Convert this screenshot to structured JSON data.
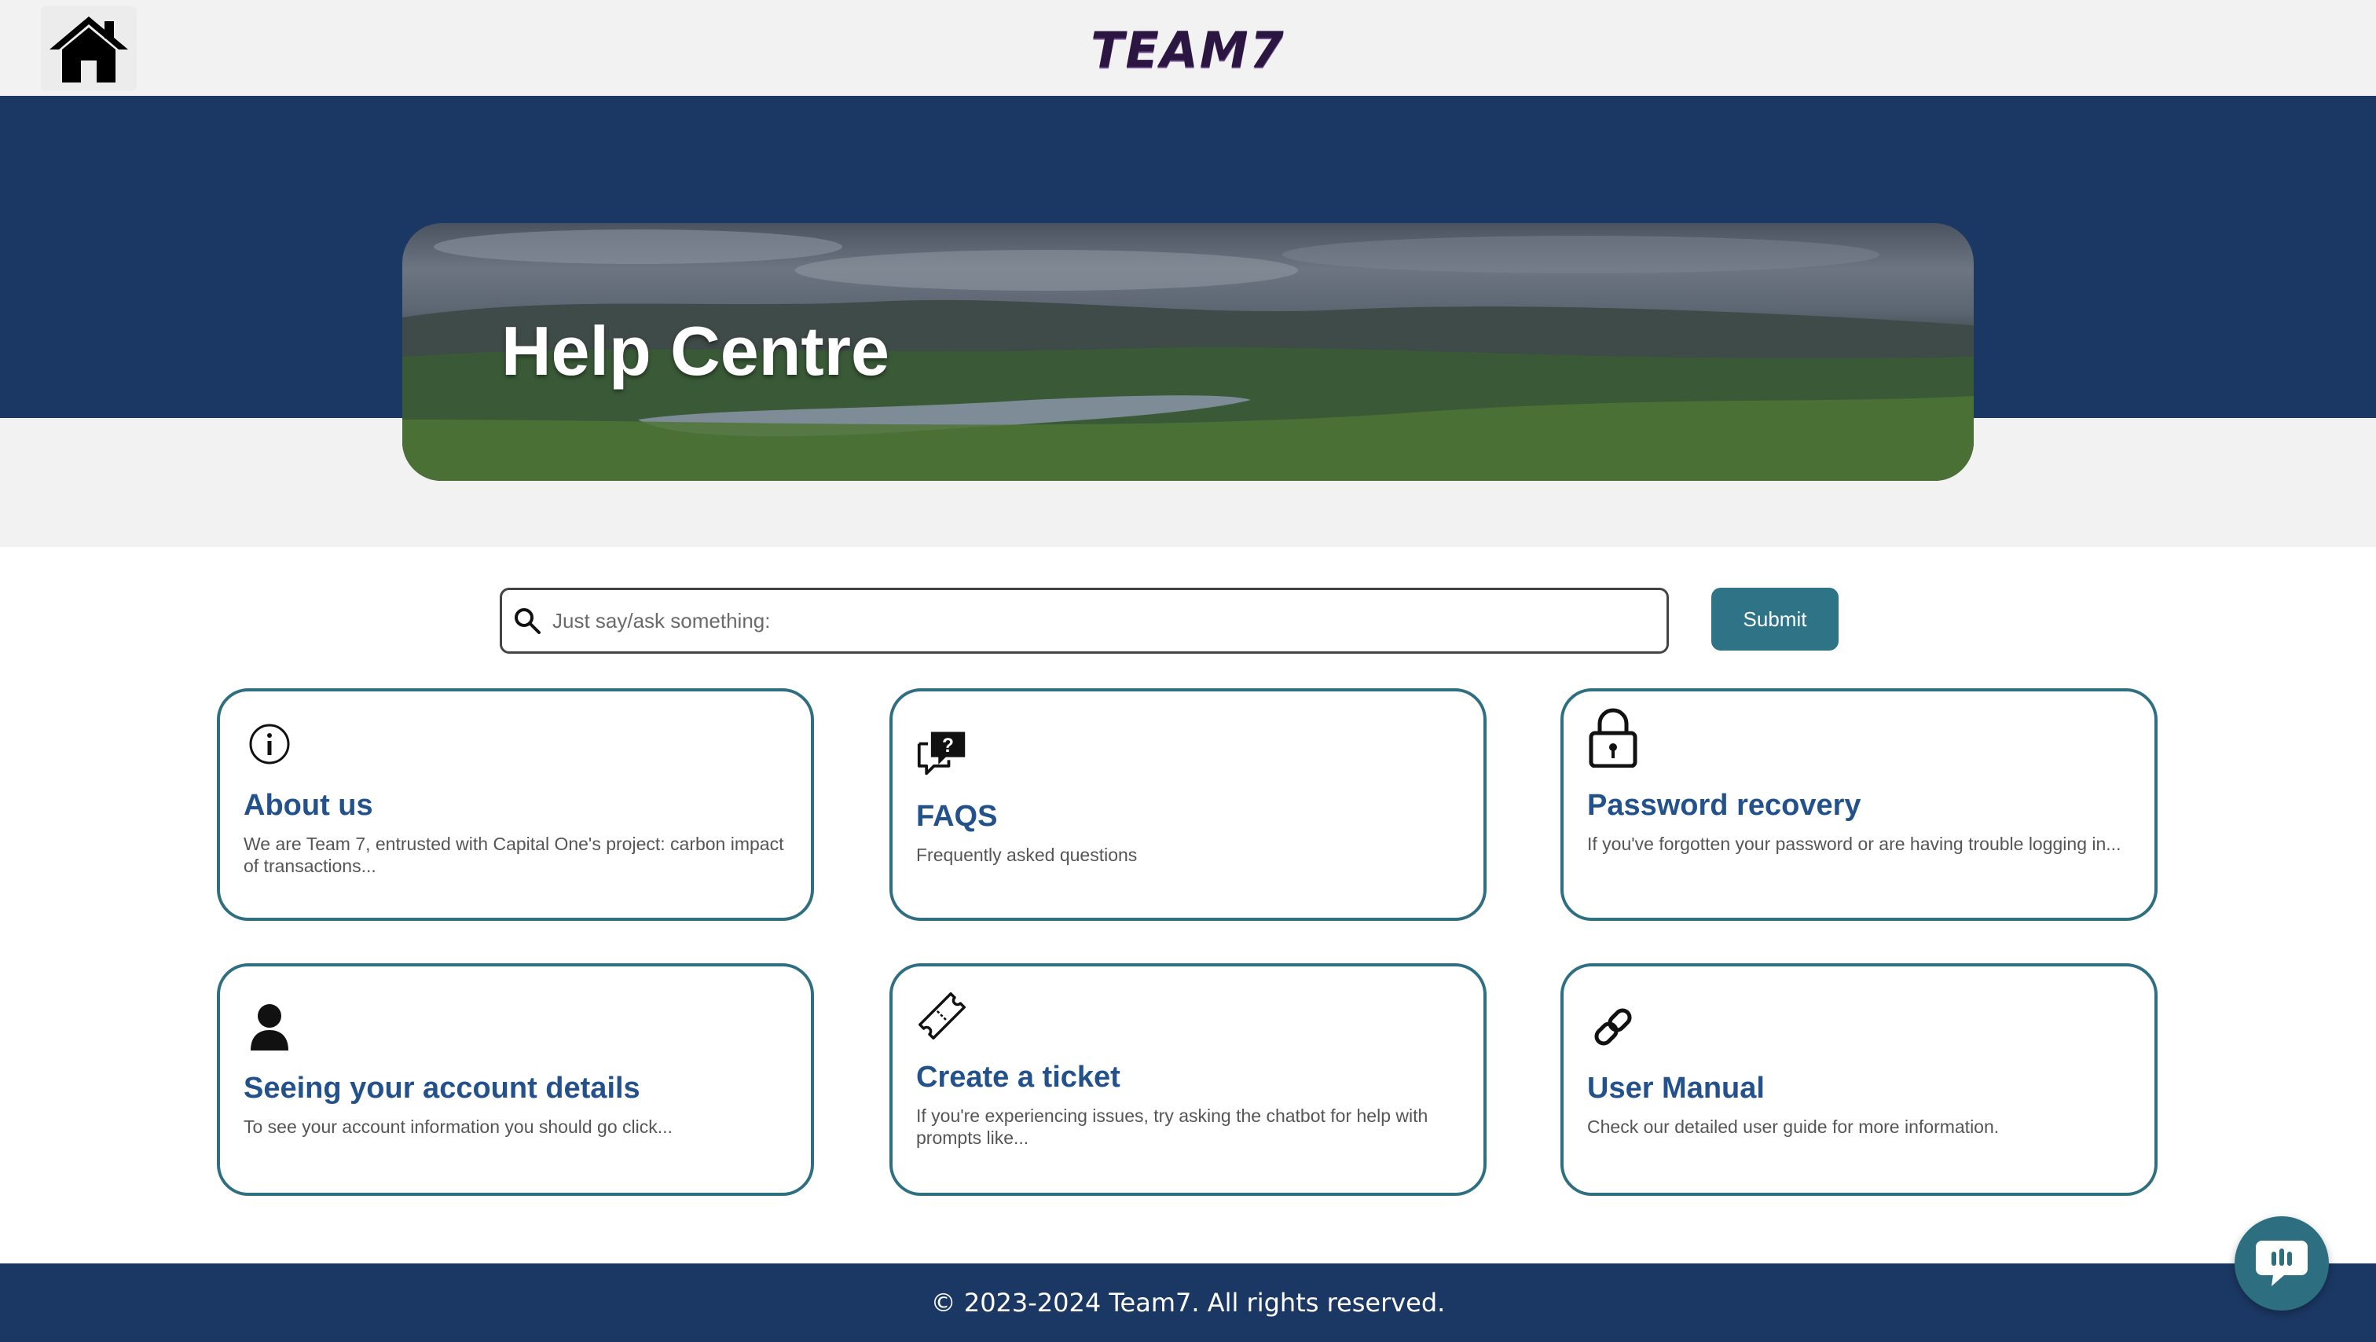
{
  "header": {
    "home_icon": "home-icon",
    "logo_text": "TEAM7"
  },
  "hero": {
    "title": "Help Centre"
  },
  "search": {
    "placeholder": "Just say/ask something:",
    "icon": "search-icon",
    "submit_label": "Submit"
  },
  "cards": [
    {
      "icon": "info-icon",
      "title": "About us",
      "desc": "We are Team 7, entrusted with Capital One's project: carbon impact of transactions..."
    },
    {
      "icon": "faq-chat-icon",
      "title": "FAQS",
      "desc": "Frequently asked questions"
    },
    {
      "icon": "padlock-icon",
      "title": "Password recovery",
      "desc": "If you've forgotten your password or are having trouble logging in..."
    },
    {
      "icon": "user-icon",
      "title": "Seeing your account details",
      "desc": "To see your account information you should go click..."
    },
    {
      "icon": "ticket-icon",
      "title": "Create a ticket",
      "desc": "If you're experiencing issues, try asking the chatbot for help with prompts like..."
    },
    {
      "icon": "link-icon",
      "title": "User Manual",
      "desc": "Check our detailed user guide for more information."
    }
  ],
  "footer": {
    "text": "© 2023-2024 Team7. All rights reserved."
  },
  "chat": {
    "icon": "chat-bubble-icon"
  },
  "colors": {
    "navy": "#1b3864",
    "teal": "#2f7386",
    "card_title": "#23518c",
    "page_bg": "#f2f2f2"
  }
}
